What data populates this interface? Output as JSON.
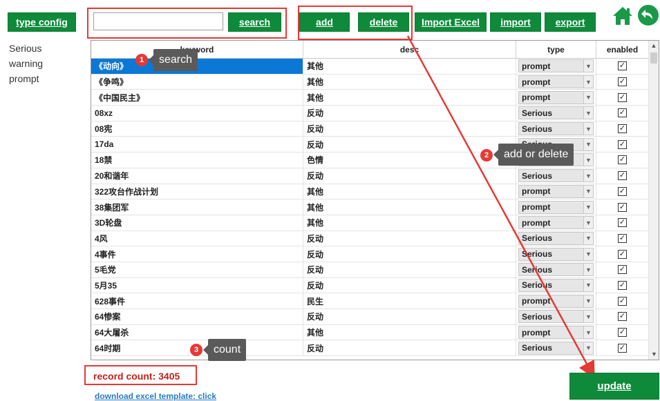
{
  "toolbar": {
    "type_config_label": "type config",
    "search_placeholder": "",
    "search_label": "search",
    "add_label": "add",
    "delete_label": "delete",
    "import_excel_label": "Import Excel",
    "import_label": "import",
    "export_label": "export",
    "home_icon": "home-icon",
    "back_icon": "back-arrow-icon"
  },
  "sidebar": {
    "types": [
      "Serious",
      "warning",
      "prompt"
    ]
  },
  "table": {
    "columns": [
      "keyword",
      "desc",
      "type",
      "enabled"
    ],
    "rows": [
      {
        "keyword": "《动向》",
        "desc": "其他",
        "type": "prompt",
        "enabled": "☑"
      },
      {
        "keyword": "《争鸣》",
        "desc": "其他",
        "type": "prompt",
        "enabled": "☑"
      },
      {
        "keyword": "《中国民主》",
        "desc": "其他",
        "type": "prompt",
        "enabled": "☑"
      },
      {
        "keyword": "08xz",
        "desc": "反动",
        "type": "Serious",
        "enabled": "☑"
      },
      {
        "keyword": "08宪",
        "desc": "反动",
        "type": "Serious",
        "enabled": "☑"
      },
      {
        "keyword": "17da",
        "desc": "反动",
        "type": "Serious",
        "enabled": "☑"
      },
      {
        "keyword": "18禁",
        "desc": "色情",
        "type": "warning",
        "enabled": "☑"
      },
      {
        "keyword": "20和谐年",
        "desc": "反动",
        "type": "Serious",
        "enabled": "☑"
      },
      {
        "keyword": "322攻台作战计划",
        "desc": "其他",
        "type": "prompt",
        "enabled": "☑"
      },
      {
        "keyword": "38集团军",
        "desc": "其他",
        "type": "prompt",
        "enabled": "☑"
      },
      {
        "keyword": "3D轮盘",
        "desc": "其他",
        "type": "prompt",
        "enabled": "☑"
      },
      {
        "keyword": "4风",
        "desc": "反动",
        "type": "Serious",
        "enabled": "☑"
      },
      {
        "keyword": "4事件",
        "desc": "反动",
        "type": "Serious",
        "enabled": "☑"
      },
      {
        "keyword": "5毛党",
        "desc": "反动",
        "type": "Serious",
        "enabled": "☑"
      },
      {
        "keyword": "5月35",
        "desc": "反动",
        "type": "Serious",
        "enabled": "☑"
      },
      {
        "keyword": "628事件",
        "desc": "民生",
        "type": "prompt",
        "enabled": "☑"
      },
      {
        "keyword": "64惨案",
        "desc": "反动",
        "type": "Serious",
        "enabled": "☑"
      },
      {
        "keyword": "64大屠杀",
        "desc": "其他",
        "type": "prompt",
        "enabled": "☑"
      },
      {
        "keyword": "64时期",
        "desc": "反动",
        "type": "Serious",
        "enabled": "☑"
      }
    ]
  },
  "annotations": {
    "search": {
      "num": "1",
      "text": "search"
    },
    "add_delete": {
      "num": "2",
      "text": "add or delete"
    },
    "count": {
      "num": "3",
      "text": "count"
    }
  },
  "footer": {
    "record_count": "record count: 3405",
    "download_link": "download excel template: click",
    "update_label": "update"
  },
  "colors": {
    "button_green": "#0e8a3a",
    "highlight_red": "#e53935",
    "selection_blue": "#0a78d4"
  }
}
